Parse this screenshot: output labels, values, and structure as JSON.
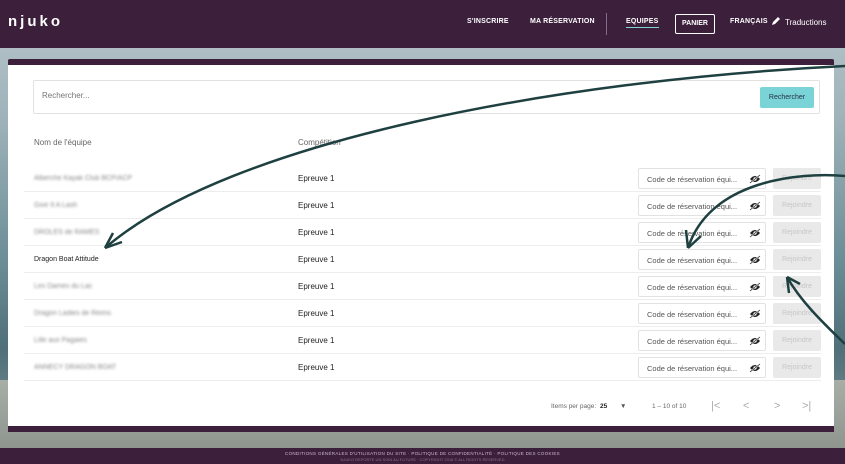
{
  "header": {
    "logo": "njuko",
    "nav": {
      "signup": "S'INSCRIRE",
      "my_reservation": "MA RÉSERVATION",
      "teams": "EQUIPES",
      "cart": "PANIER",
      "language": "FRANÇAIS",
      "translations": "Traductions"
    }
  },
  "search": {
    "placeholder": "Rechercher...",
    "button": "Rechercher"
  },
  "table": {
    "columns": [
      "Nom de l'équipe",
      "Compétition"
    ],
    "code_placeholder": "Code de réservation équi...",
    "join_label": "Rejoindre",
    "rows": [
      {
        "team": "Alberche Kayak Club BCP/ACP",
        "competition": "Epreuve 1"
      },
      {
        "team": "Give It A Lash",
        "competition": "Epreuve 1"
      },
      {
        "team": "DROLES de RAMES",
        "competition": "Epreuve 1"
      },
      {
        "team": "Dragon Boat Attitude",
        "competition": "Epreuve 1"
      },
      {
        "team": "Les Dames du Lac",
        "competition": "Epreuve 1"
      },
      {
        "team": "Dragon Ladies de Reims",
        "competition": "Epreuve 1"
      },
      {
        "team": "Lille aux Pagaies",
        "competition": "Epreuve 1"
      },
      {
        "team": "ANNECY DRAGON BOAT",
        "competition": "Epreuve 1"
      }
    ]
  },
  "pagination": {
    "items_per_page_label": "Items per page:",
    "items_per_page": "25",
    "range": "1 – 10 of 10"
  },
  "footer": {
    "links": "CONDITIONS GÉNÉRALES D'UTILISATION DU SITE · POLITIQUE DE CONFIDENTIALITÉ · POLITIQUE DES COOKIES",
    "copyright": "NJUKO REPORTE UN SOIN AU FUTURE · COPYRIGHT 2018 © ALL RIGHTS RESERVED"
  },
  "colors": {
    "brand": "#3b1f3b",
    "accent": "#7ad3d6",
    "annotation": "#1f4040"
  }
}
